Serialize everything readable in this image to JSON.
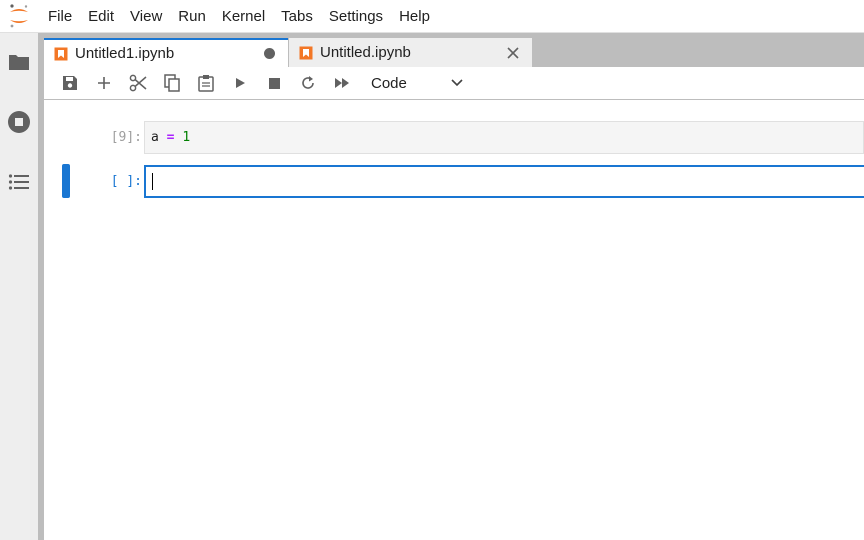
{
  "menubar": {
    "logo": "jupyter-logo-icon",
    "items": [
      "File",
      "Edit",
      "View",
      "Run",
      "Kernel",
      "Tabs",
      "Settings",
      "Help"
    ]
  },
  "leftbar": {
    "icons": [
      "folder-icon",
      "running-sessions-icon",
      "table-of-contents-icon"
    ]
  },
  "tabs": [
    {
      "label": "Untitled1.ipynb",
      "active": true,
      "status": "unsaved"
    },
    {
      "label": "Untitled.ipynb",
      "active": false,
      "status": "closable"
    }
  ],
  "toolbar": {
    "buttons": [
      "save-icon",
      "add-cell-icon",
      "cut-icon",
      "copy-icon",
      "paste-icon",
      "run-icon",
      "stop-icon",
      "restart-icon",
      "run-all-icon"
    ],
    "cell_type": "Code"
  },
  "cells": [
    {
      "prompt": "[9]:",
      "code": {
        "var": "a",
        "op": "=",
        "num": "1"
      },
      "active": false
    },
    {
      "prompt": "[ ]:",
      "code": "",
      "active": true
    }
  ],
  "colors": {
    "accent": "#1976d2",
    "operator": "#aa22ff",
    "number": "#008000",
    "logo": "#f37726"
  }
}
